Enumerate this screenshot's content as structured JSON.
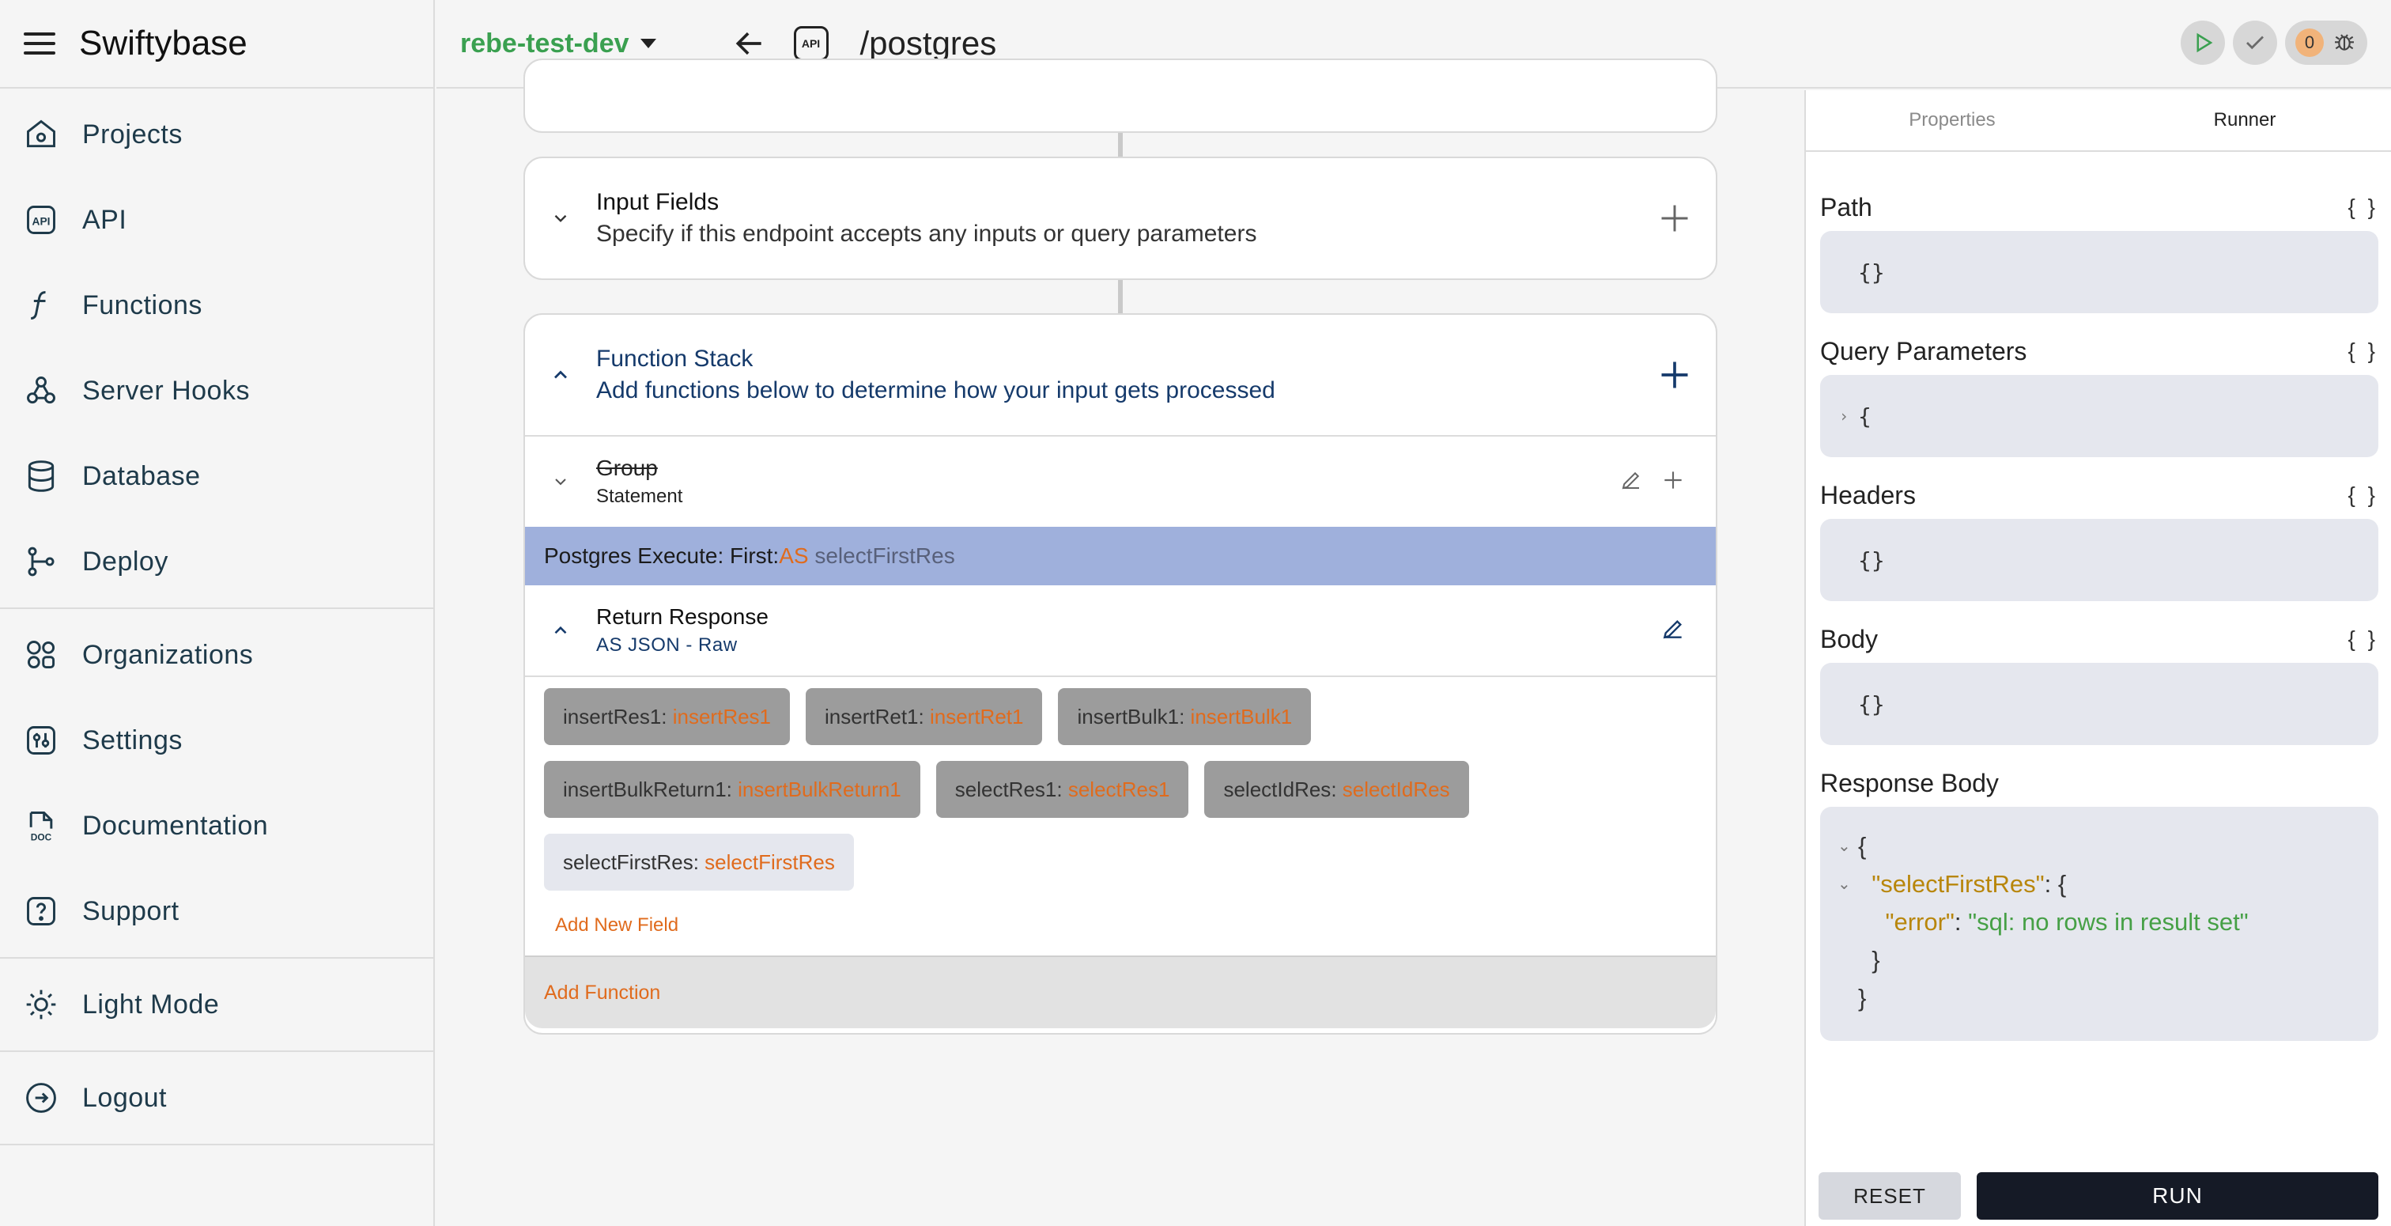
{
  "brand": {
    "name": "Swiftybase"
  },
  "sidebar": {
    "groups": [
      [
        {
          "label": "Projects",
          "icon": "house-icon"
        },
        {
          "label": "API",
          "icon": "api-icon"
        },
        {
          "label": "Functions",
          "icon": "function-icon"
        },
        {
          "label": "Server Hooks",
          "icon": "webhook-icon"
        },
        {
          "label": "Database",
          "icon": "database-icon"
        },
        {
          "label": "Deploy",
          "icon": "git-branch-icon"
        }
      ],
      [
        {
          "label": "Organizations",
          "icon": "shapes-icon"
        },
        {
          "label": "Settings",
          "icon": "settings-icon"
        },
        {
          "label": "Documentation",
          "icon": "doc-icon"
        },
        {
          "label": "Support",
          "icon": "help-icon"
        }
      ],
      [
        {
          "label": "Light Mode",
          "icon": "sun-icon"
        }
      ],
      [
        {
          "label": "Logout",
          "icon": "logout-icon"
        }
      ]
    ]
  },
  "topbar": {
    "environment": "rebe-test-dev",
    "api_badge": "API",
    "route": "/postgres",
    "error_count": "0",
    "accent": "#3aa050"
  },
  "main": {
    "input_fields": {
      "title": "Input Fields",
      "subtitle": "Specify if this endpoint accepts any inputs or query parameters"
    },
    "function_stack": {
      "title": "Function Stack",
      "subtitle": "Add functions below to determine how your input gets processed",
      "group": {
        "title": "Group",
        "subtitle": "Statement"
      },
      "pg_row": {
        "prefix": "Postgres Execute: First: ",
        "as": "AS",
        "name": "selectFirstRes"
      },
      "return_response": {
        "title": "Return Response",
        "subtitle": "AS JSON - Raw"
      },
      "fields": [
        {
          "key": "insertRes1",
          "value": "insertRes1",
          "style": "dark"
        },
        {
          "key": "insertRet1",
          "value": "insertRet1",
          "style": "dark"
        },
        {
          "key": "insertBulk1",
          "value": "insertBulk1",
          "style": "dark"
        },
        {
          "key": "insertBulkReturn1",
          "value": "insertBulkReturn1",
          "style": "dark"
        },
        {
          "key": "selectRes1",
          "value": "selectRes1",
          "style": "dark"
        },
        {
          "key": "selectIdRes",
          "value": "selectIdRes",
          "style": "dark"
        },
        {
          "key": "selectFirstRes",
          "value": "selectFirstRes",
          "style": "light"
        }
      ],
      "add_field_label": "Add New Field",
      "add_function_label": "Add Function"
    }
  },
  "runner": {
    "tabs": [
      "Properties",
      "Runner"
    ],
    "active_tab": "Runner",
    "braces": "{ }",
    "path": {
      "title": "Path",
      "value": "{}"
    },
    "query": {
      "title": "Query Parameters",
      "value": "{"
    },
    "headers": {
      "title": "Headers",
      "value": "{}"
    },
    "body": {
      "title": "Body",
      "value": "{}"
    },
    "response": {
      "title": "Response Body",
      "open": "{",
      "key1": "\"selectFirstRes\"",
      "key2": "\"error\"",
      "val2": "\"sql: no rows in result set\"",
      "close_inner": "}",
      "close_outer": "}"
    },
    "reset_label": "RESET",
    "run_label": "RUN"
  }
}
